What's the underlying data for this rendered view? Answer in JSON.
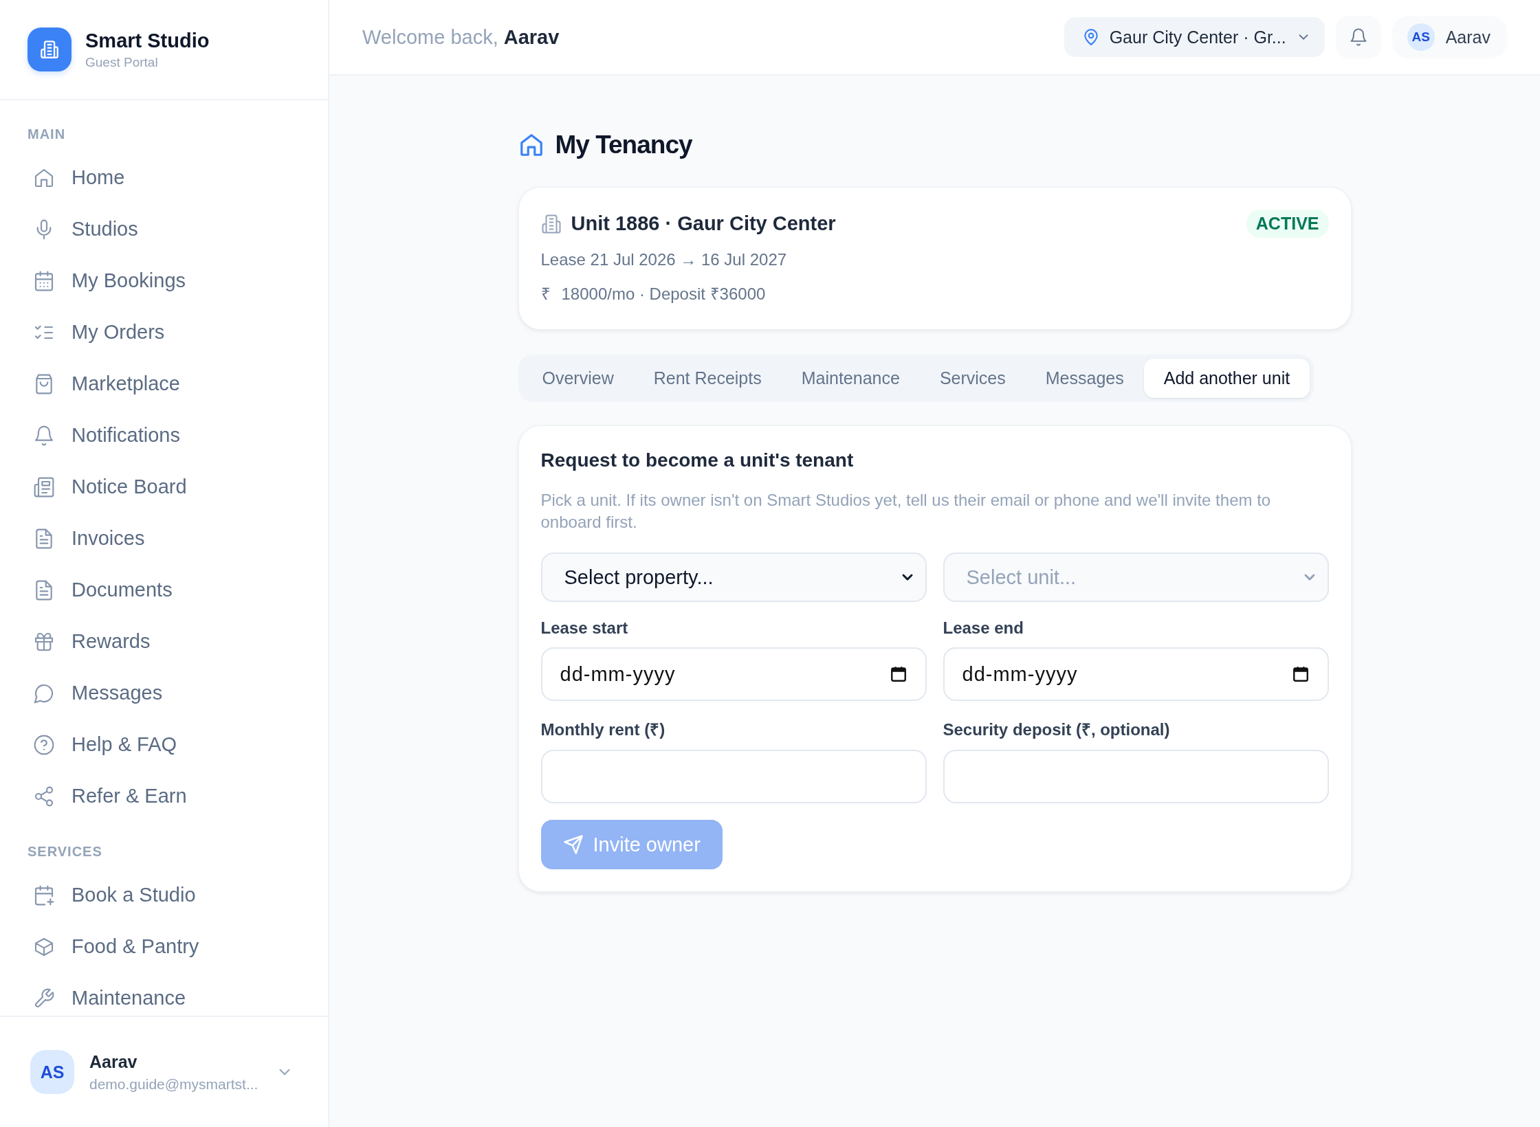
{
  "brand": {
    "title": "Smart Studio",
    "subtitle": "Guest Portal"
  },
  "sidebar": {
    "sections": [
      {
        "heading": "MAIN",
        "items": [
          {
            "label": "Home"
          },
          {
            "label": "Studios"
          },
          {
            "label": "My Bookings"
          },
          {
            "label": "My Orders"
          },
          {
            "label": "Marketplace"
          },
          {
            "label": "Notifications"
          },
          {
            "label": "Notice Board"
          },
          {
            "label": "Invoices"
          },
          {
            "label": "Documents"
          },
          {
            "label": "Rewards"
          },
          {
            "label": "Messages"
          },
          {
            "label": "Help & FAQ"
          },
          {
            "label": "Refer & Earn"
          }
        ]
      },
      {
        "heading": "SERVICES",
        "items": [
          {
            "label": "Book a Studio"
          },
          {
            "label": "Food & Pantry"
          },
          {
            "label": "Maintenance"
          }
        ]
      }
    ],
    "user": {
      "initials": "AS",
      "name": "Aarav",
      "email": "demo.guide@mysmartst..."
    }
  },
  "header": {
    "greeting": "Welcome back,",
    "name": "Aarav",
    "location": "Gaur City Center · Gr...",
    "user_initials": "AS",
    "user_name": "Aarav"
  },
  "page_title": "My Tenancy",
  "tenancy": {
    "unit": "Unit 1886 · Gaur City Center",
    "status": "ACTIVE",
    "lease": "Lease 21 Jul 2026 → 16 Jul 2027",
    "currency": "₹",
    "rent": "18000/mo · Deposit ₹36000"
  },
  "tabs": [
    {
      "label": "Overview",
      "selected": false
    },
    {
      "label": "Rent Receipts",
      "selected": false
    },
    {
      "label": "Maintenance",
      "selected": false
    },
    {
      "label": "Services",
      "selected": false
    },
    {
      "label": "Messages",
      "selected": false
    },
    {
      "label": "Add another unit",
      "selected": true
    }
  ],
  "form": {
    "title": "Request to become a unit's tenant",
    "description": "Pick a unit. If its owner isn't on Smart Studios yet, tell us their email or phone and we'll invite them to onboard first.",
    "selects": [
      {
        "value": "Select property...",
        "disabled": false
      },
      {
        "value": "Select unit...",
        "disabled": true
      }
    ],
    "fields": [
      {
        "label": "Lease start",
        "kind": "date",
        "placeholder": "dd-mm-yyyy"
      },
      {
        "label": "Lease end",
        "kind": "date",
        "placeholder": "dd-mm-yyyy"
      },
      {
        "label": "Monthly rent (₹)",
        "kind": "text"
      },
      {
        "label": "Security deposit (₹, optional)",
        "kind": "text"
      }
    ],
    "button": {
      "label": "Invite owner",
      "disabled": true
    }
  }
}
